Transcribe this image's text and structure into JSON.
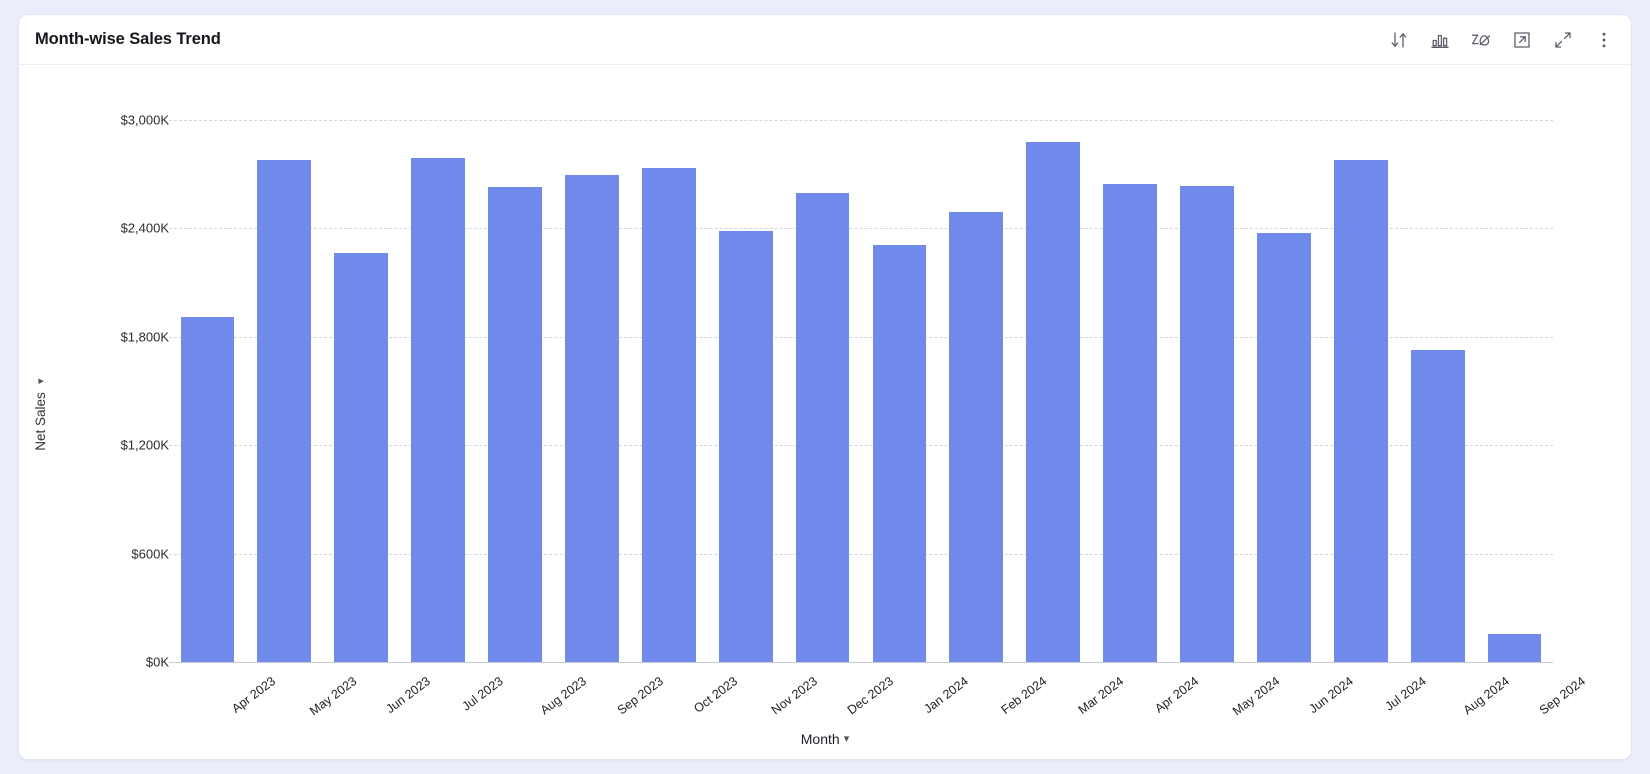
{
  "header": {
    "title": "Month-wise Sales Trend",
    "toolbar": [
      {
        "name": "sort-icon",
        "label": "Sort"
      },
      {
        "name": "bar-chart-icon",
        "label": "Chart type"
      },
      {
        "name": "annotate-icon",
        "label": "Annotate"
      },
      {
        "name": "open-external-icon",
        "label": "Open in new tab"
      },
      {
        "name": "expand-icon",
        "label": "Expand"
      },
      {
        "name": "more-options-icon",
        "label": "More options"
      }
    ]
  },
  "chart_data": {
    "type": "bar",
    "title": "Month-wise Sales Trend",
    "xlabel": "Month",
    "ylabel": "Net Sales",
    "ylim": [
      0,
      3000
    ],
    "grid": true,
    "legend": false,
    "bar_color": "#6f8aea",
    "y_ticks": [
      0,
      600,
      1200,
      1800,
      2400,
      3000
    ],
    "y_tick_labels": [
      "$0K",
      "$600K",
      "$1,200K",
      "$1,800K",
      "$2,400K",
      "$3,000K"
    ],
    "value_unit": "K USD",
    "categories": [
      "Apr 2023",
      "May 2023",
      "Jun 2023",
      "Jul 2023",
      "Aug 2023",
      "Sep 2023",
      "Oct 2023",
      "Nov 2023",
      "Dec 2023",
      "Jan 2024",
      "Feb 2024",
      "Mar 2024",
      "Apr 2024",
      "May 2024",
      "Jun 2024",
      "Jul 2024",
      "Aug 2024",
      "Sep 2024"
    ],
    "values": [
      1910,
      2780,
      2265,
      2790,
      2630,
      2695,
      2735,
      2385,
      2595,
      2310,
      2490,
      2880,
      2645,
      2635,
      2375,
      2780,
      1725,
      155
    ]
  }
}
